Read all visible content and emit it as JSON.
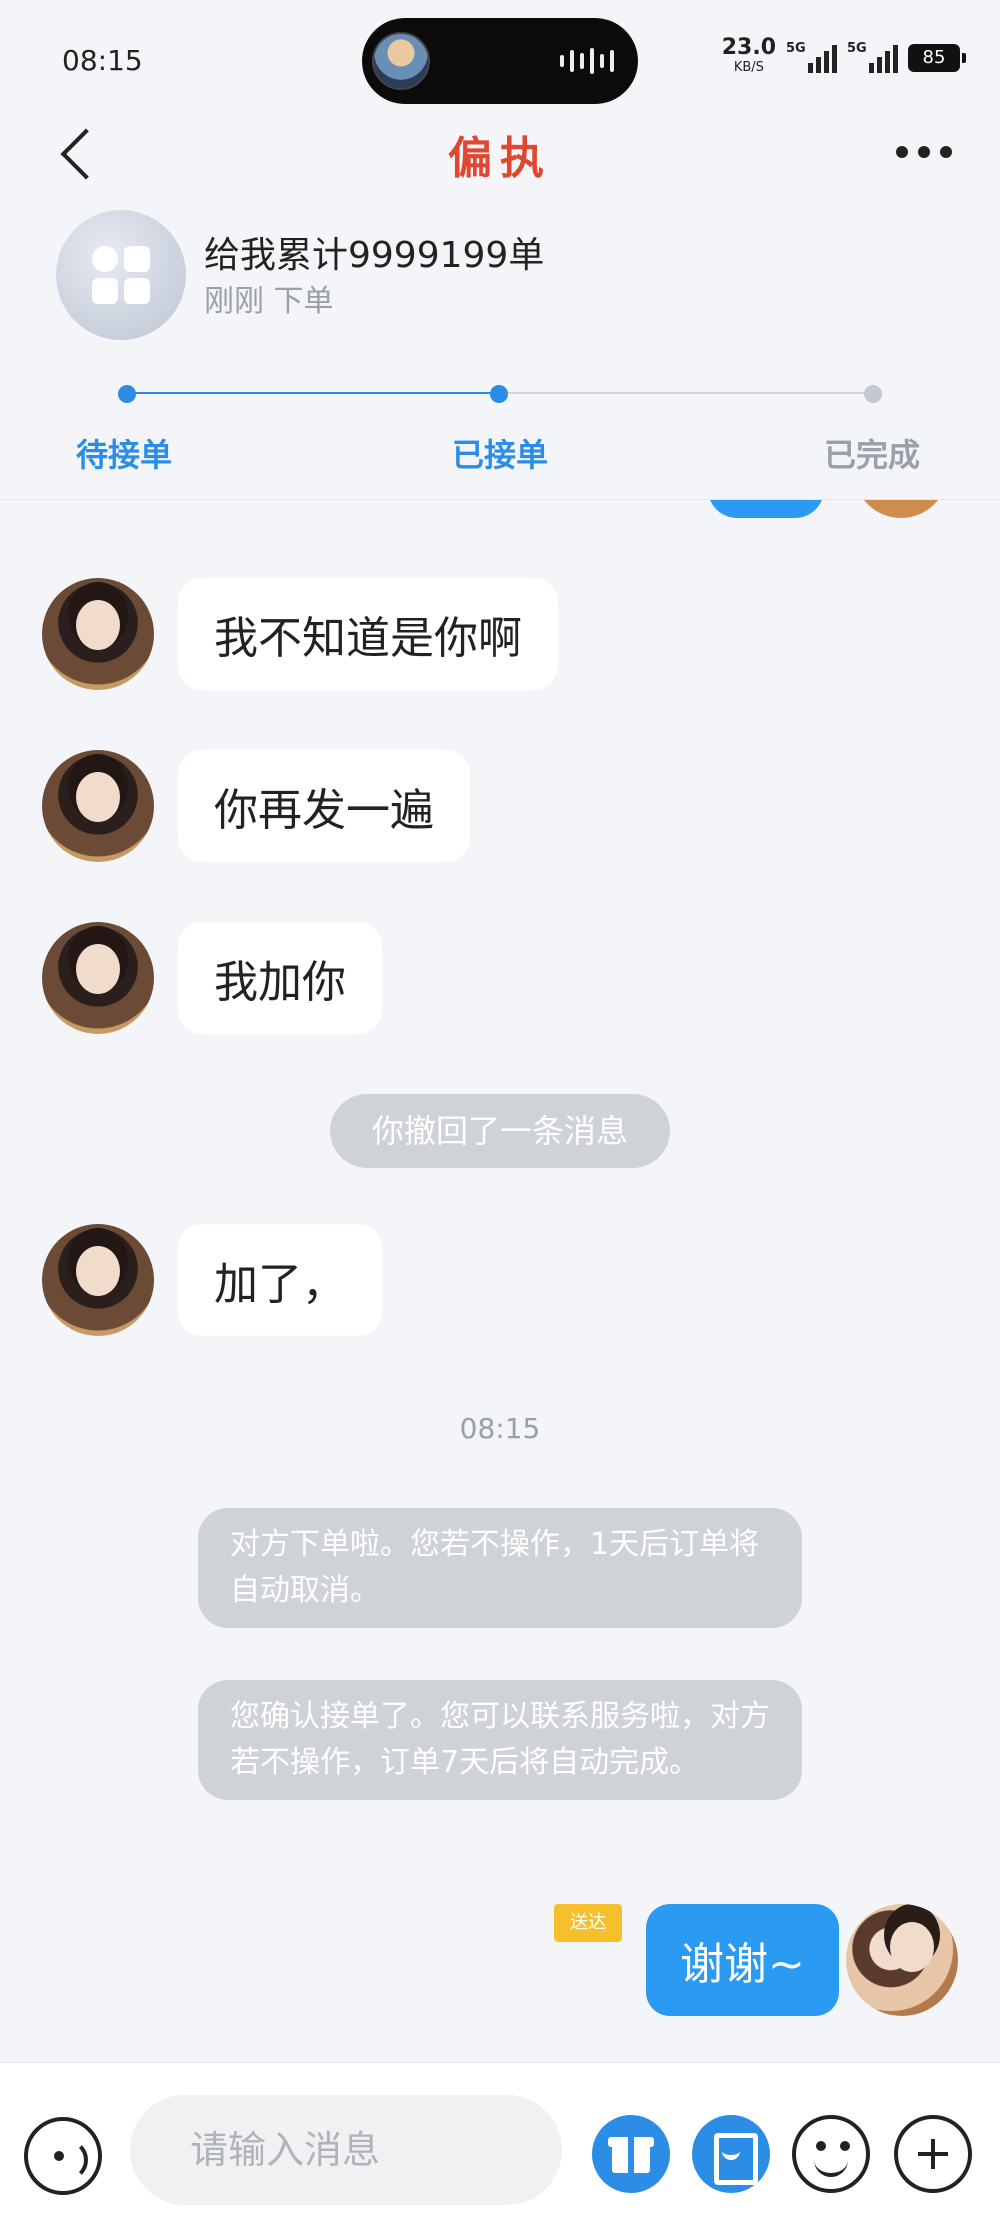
{
  "status_bar": {
    "time": "08:15",
    "net_speed": "23.0",
    "net_unit": "KB/S",
    "signal_1": "5G",
    "signal_2": "5G",
    "battery": "85"
  },
  "nav": {
    "title": "偏执"
  },
  "order": {
    "title": "给我累计9999199单",
    "subtitle": "刚刚 下单",
    "steps": [
      {
        "label": "待接单",
        "color": "#2b8de6"
      },
      {
        "label": "已接单",
        "color": "#2b8de6"
      },
      {
        "label": "已完成",
        "color": "#9aa0a8"
      }
    ],
    "progress": 0.5
  },
  "messages": [
    {
      "text": "我不知道是你啊"
    },
    {
      "text": "你再发一遍"
    },
    {
      "text": "我加你"
    },
    {
      "text": "你撤回了一条消息"
    },
    {
      "text": "加了，"
    },
    {
      "text": "08:15"
    },
    {
      "text": "对方下单啦。您若不操作，1天后订单将自动取消。"
    },
    {
      "text": "您确认接单了。您可以联系服务啦，对方若不操作，订单7天后将自动完成。"
    },
    {
      "tag": "送达",
      "text": "谢谢~"
    }
  ],
  "input": {
    "placeholder": "请输入消息"
  },
  "colors": {
    "accent": "#2b9af3",
    "title_red": "#e0472e",
    "system_bubble": "#cfd3d8",
    "tag_yellow": "#f6c02c"
  }
}
